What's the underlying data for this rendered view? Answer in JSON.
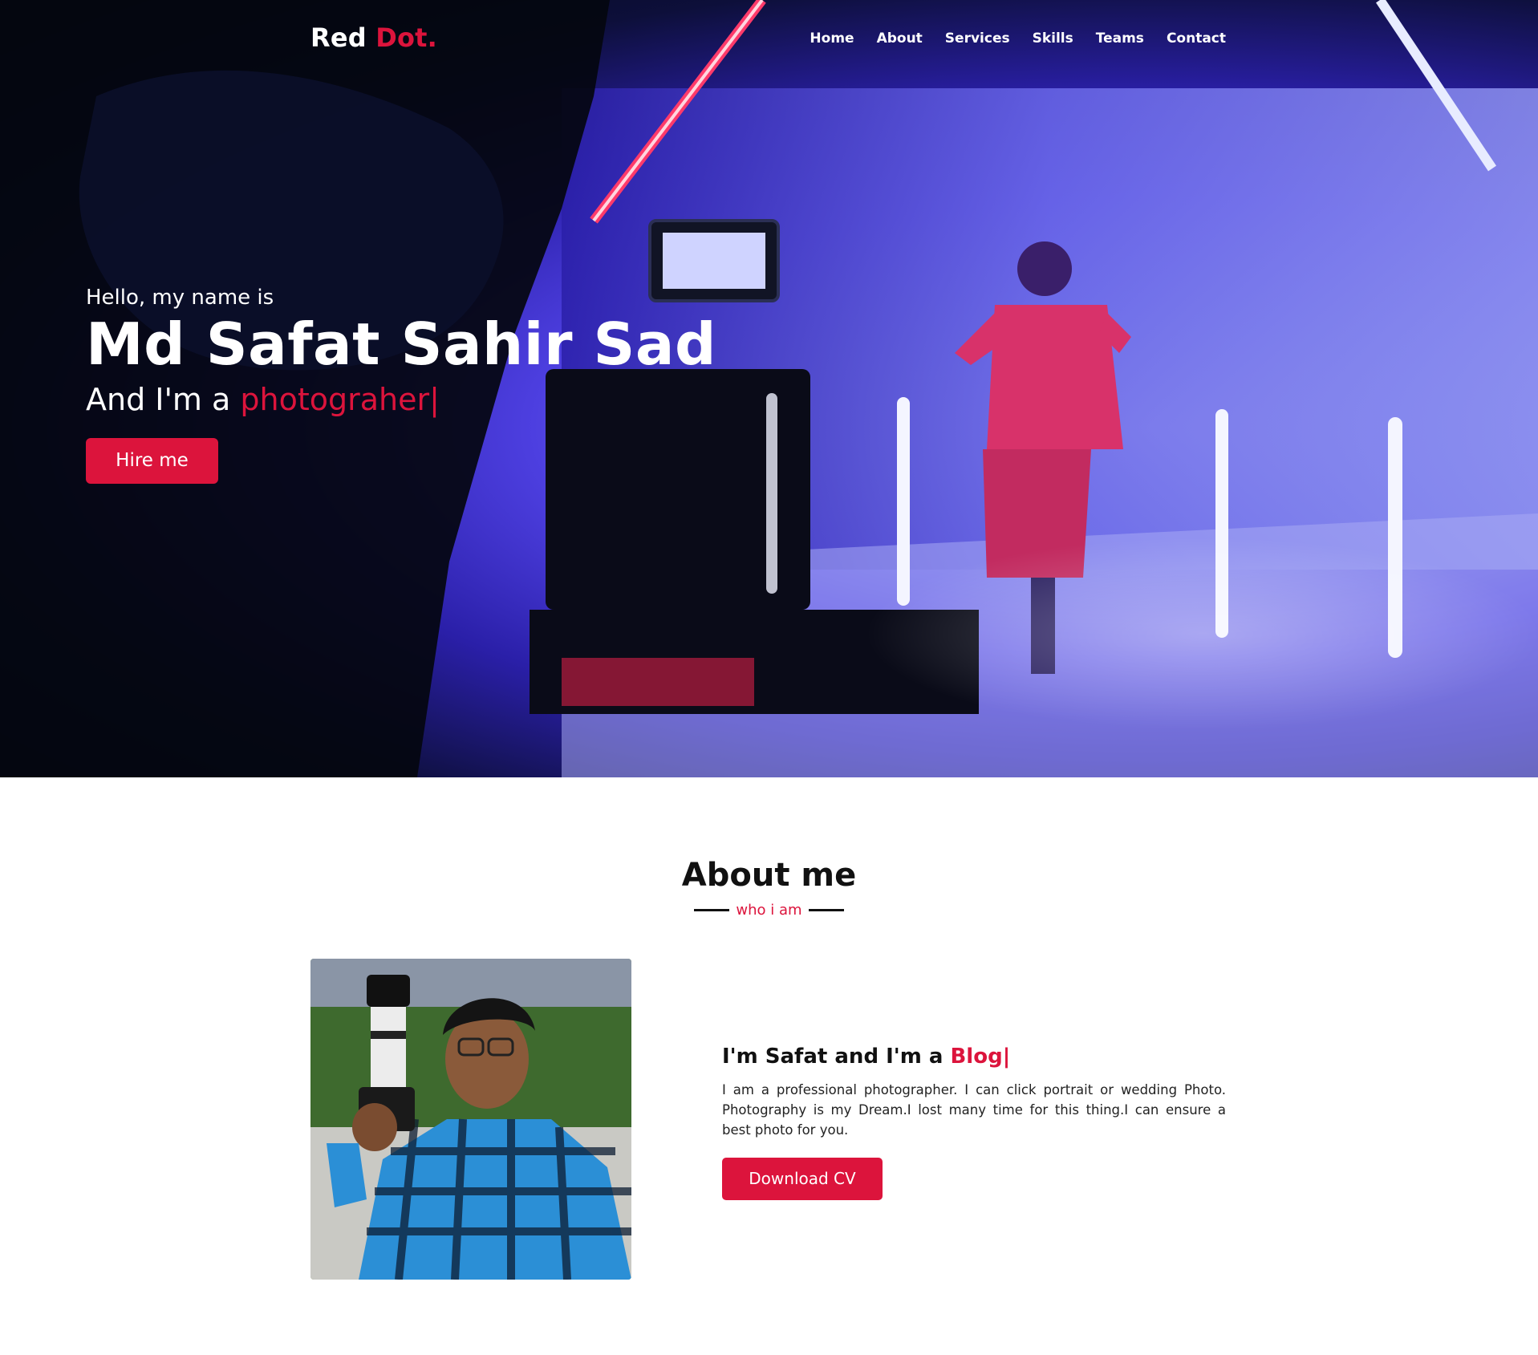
{
  "nav": {
    "logo_main": "Red ",
    "logo_accent": "Dot.",
    "items": [
      "Home",
      "About",
      "Services",
      "Skills",
      "Teams",
      "Contact"
    ]
  },
  "hero": {
    "greeting": "Hello, my name is",
    "name": "Md Safat Sahir Sad",
    "role_prefix": "And I'm a ",
    "role_typed": "photograher",
    "caret": "|",
    "hire_label": "Hire me"
  },
  "about": {
    "title": "About me",
    "subtitle": "who i am",
    "heading_prefix": "I'm Safat and I'm a ",
    "heading_typed": "Blog",
    "caret": "|",
    "paragraph": "I am a professional photographer. I can click portrait or wedding Photo. Photography is my Dream.I lost many time for this thing.I can ensure a best photo for you.",
    "cv_label": "Download CV"
  },
  "colors": {
    "accent": "#dc143c",
    "hero_dark": "#03050d",
    "hero_blue": "#4d3fe0"
  }
}
